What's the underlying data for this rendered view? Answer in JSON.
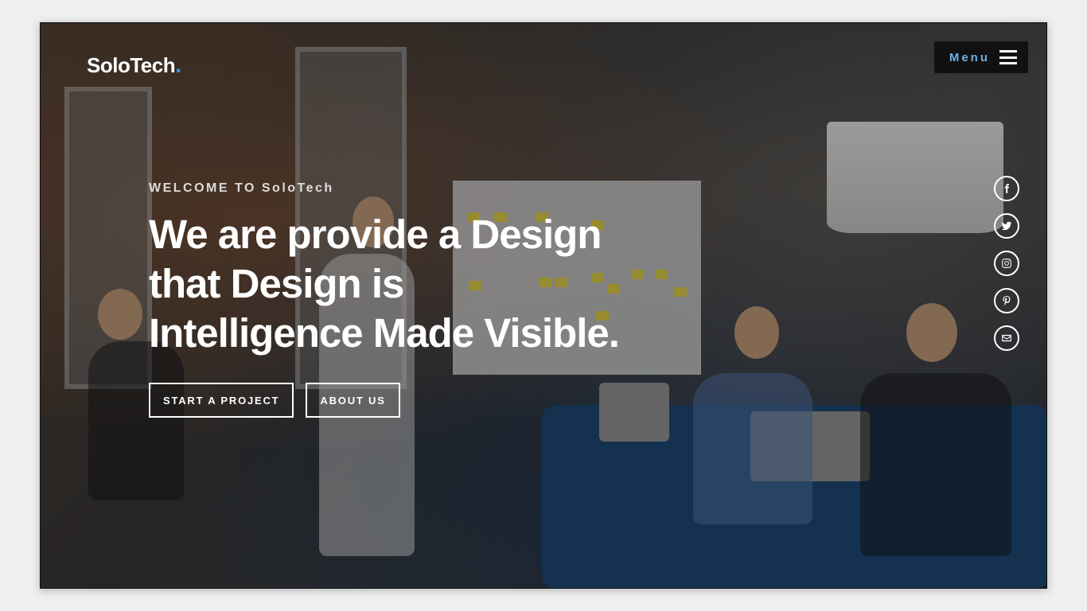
{
  "brand": {
    "name": "SoloTech",
    "accent_dot": ".",
    "accent_color": "#3a8ee6"
  },
  "menu": {
    "label": "Menu"
  },
  "hero": {
    "welcome": "WELCOME TO SoloTech",
    "headline": "We are provide a Design\nthat Design is\nIntelligence Made Visible.",
    "buttons": {
      "primary": "START A PROJECT",
      "secondary": "ABOUT US"
    }
  },
  "social": {
    "icons": [
      "facebook-icon",
      "twitter-icon",
      "instagram-icon",
      "pinterest-icon",
      "envelope-icon"
    ]
  }
}
